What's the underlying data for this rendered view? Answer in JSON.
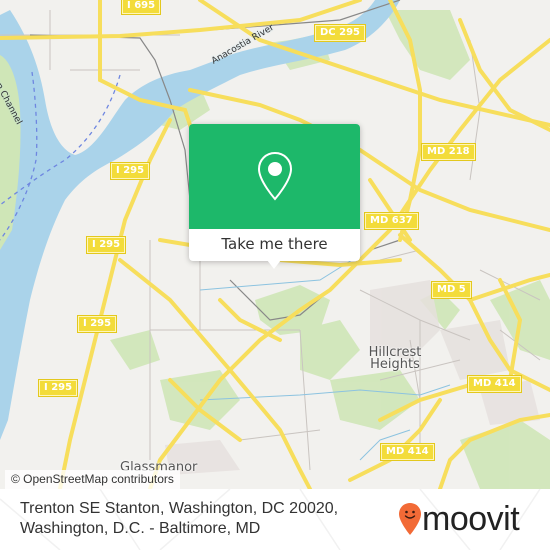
{
  "map": {
    "road_badges": [
      {
        "id": "i695",
        "label": "I 695"
      },
      {
        "id": "dc295",
        "label": "DC 295"
      },
      {
        "id": "md218",
        "label": "MD 218"
      },
      {
        "id": "md637",
        "label": "MD 637"
      },
      {
        "id": "i295a",
        "label": "I 295"
      },
      {
        "id": "i295b",
        "label": "I 295"
      },
      {
        "id": "i295c",
        "label": "I 295"
      },
      {
        "id": "i295d",
        "label": "I 295"
      },
      {
        "id": "md5",
        "label": "MD 5"
      },
      {
        "id": "md414a",
        "label": "MD 414"
      },
      {
        "id": "md414b",
        "label": "MD 414"
      }
    ],
    "places": {
      "hillcrest": "Hillcrest\nHeights",
      "glassmanor": "Glassmanor"
    },
    "water_labels": {
      "anacostia": "Anacostia River",
      "channel": "Washington Channel"
    },
    "attribution": "© OpenStreetMap contributors"
  },
  "popup": {
    "icon": "location-pin-icon",
    "cta_label": "Take me there",
    "accent_color": "#1db86a"
  },
  "footer": {
    "address_line1": "Trenton SE Stanton, Washington, DC 20020,",
    "address_line2": "Washington, D.C. - Baltimore, MD",
    "brand": "moovit",
    "brand_color": "#f26a36"
  }
}
